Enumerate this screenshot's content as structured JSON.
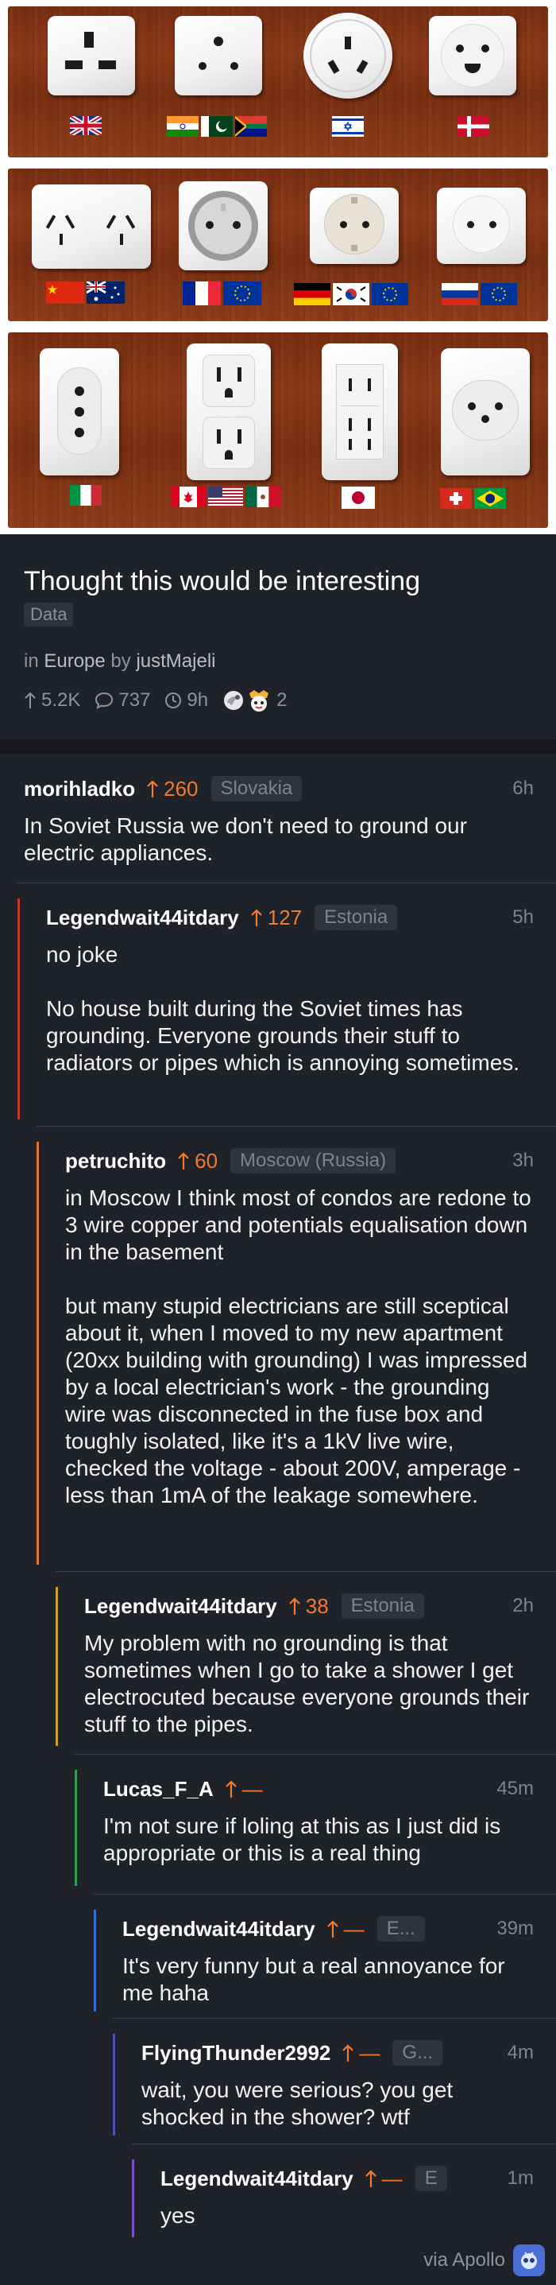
{
  "post": {
    "title": "Thought this would be interesting",
    "flair": "Data",
    "in_label": "in",
    "subreddit": "Europe",
    "by_label": "by",
    "author": "justMajeli",
    "upvotes": "5.2K",
    "comments": "737",
    "age": "9h",
    "award_count": "2"
  },
  "comments": [
    {
      "user": "morihladko",
      "score": "260",
      "flair": "Slovakia",
      "time": "6h",
      "paragraphs": [
        "In Soviet Russia we don't need to ground our electric appliances."
      ]
    },
    {
      "user": "Legendwait44itdary",
      "score": "127",
      "flair": "Estonia",
      "time": "5h",
      "paragraphs": [
        "no joke",
        "No house built during the Soviet times has grounding. Everyone grounds their stuff to radiators or pipes which is annoying sometimes."
      ]
    },
    {
      "user": "petruchito",
      "score": "60",
      "flair": "Moscow (Russia)",
      "time": "3h",
      "paragraphs": [
        "in Moscow I think most of condos are redone to 3 wire copper and potentials equalisation down in the basement",
        "but many stupid electricians are still sceptical about it, when I moved to my new apartment (20xx building with grounding) I was impressed by a local electrician's work - the grounding wire was disconnected in the fuse box and toughly isolated, like it's a 1kV live wire, checked the voltage - about 200V, amperage - less than 1mA of the leakage somewhere."
      ]
    },
    {
      "user": "Legendwait44itdary",
      "score": "38",
      "flair": "Estonia",
      "time": "2h",
      "paragraphs": [
        "My problem with no grounding is that sometimes when I go to take a shower I get electrocuted because everyone grounds their stuff to the pipes."
      ]
    },
    {
      "user": "Lucas_F_A",
      "score": "—",
      "flair": "",
      "time": "45m",
      "paragraphs": [
        "I'm not sure if loling at this as I just did is appropriate or this is a real thing"
      ]
    },
    {
      "user": "Legendwait44itdary",
      "score": "—",
      "flair": "E...",
      "time": "39m",
      "paragraphs": [
        "It's very funny but a real annoyance for me haha"
      ]
    },
    {
      "user": "FlyingThunder2992",
      "score": "—",
      "flair": "G...",
      "time": "4m",
      "paragraphs": [
        "wait, you were serious? you get shocked in the shower? wtf"
      ]
    },
    {
      "user": "Legendwait44itdary",
      "score": "—",
      "flair": "E",
      "time": "1m",
      "paragraphs": [
        "yes"
      ]
    }
  ],
  "footer": {
    "via": "via Apollo"
  },
  "colors": {
    "background": "#1f2229",
    "accent_orange": "#f27a2d",
    "thread_red": "#c0392b",
    "thread_orange": "#d9782d",
    "thread_yellow": "#c9a227",
    "thread_green": "#3a9a4f",
    "thread_blue": "#2f6fd1",
    "thread_indigo": "#4b4fc4",
    "thread_purple": "#7a4fc0"
  },
  "image": {
    "description_icons": [
      "uk-socket",
      "india-socket",
      "israel-socket",
      "denmark-socket",
      "china-australia-socket",
      "france-socket",
      "schuko-socket",
      "russia-socket",
      "italy-socket",
      "us-socket",
      "japan-socket",
      "swiss-brazil-socket"
    ]
  }
}
